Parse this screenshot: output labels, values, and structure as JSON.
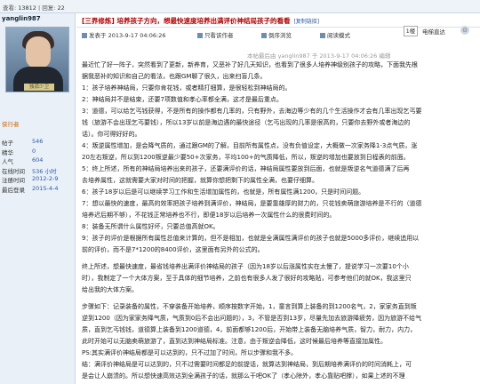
{
  "topbar": {
    "stats_label": "查看: ",
    "stats_views": "13812",
    "stats_sep": " | 回复: ",
    "stats_replies": "22"
  },
  "user": {
    "name": "yanglin987",
    "avatar_caption": "独孤少卫",
    "role": "侠行者",
    "stats": [
      {
        "k": "帖子",
        "v": "546"
      },
      {
        "k": "精华",
        "v": "0"
      },
      {
        "k": "人气",
        "v": "604"
      },
      {
        "k": "在线时间",
        "v": "536 小时"
      },
      {
        "k": "注册时间",
        "v": "2012-2-9"
      },
      {
        "k": "最后登录",
        "v": "2015-4-4"
      }
    ]
  },
  "thread": {
    "title": "[三界修炼] 培养孩子方向，想最快速度培养出满评价神结局孩子的看看",
    "copy_link": "[复制链接]",
    "page_value": "1楼",
    "goto_label": "电梯直达",
    "posted_at": "发表于 2013-9-17 04:06:26",
    "only_author": "只看该作者",
    "reverse": "倒序浏览",
    "more": "阅读模式",
    "edited_note": "本帖最后由 yanglin987 于 2013-9-17 04:06:26 编辑"
  },
  "body": [
    "最近忙了好一阵子，突然看到了更新，新养育，又恶补了好几天知识，也看到了很多人培养神级别孩子的攻略，下面我先根",
    "据我恶补的知识和自己的看法，也跟GM聊了很久，出来扫盲几条。",
    "1：孩子培养神结局，只要你肯花钱，或者精打细算，是很轻松到神结局的。",
    "2：神结局并不是结束，还要7项数值和孝心率都全满，这才是最后重点。",
    "3：道德，可以给乞丐钱获得，不是所有的操作都有几率的，只有野外，去海边等少有的几个生活操作才会有几率出现乞丐要",
    "钱（旅游不会出现乞丐要钱），所以13岁以前是海边遇的最快途径（乞丐出现的几率是很高的，只要你去野外或者海边的",
    "话）。你可得好好的。",
    "4：叛逆属性增加，是会降气质的，通过跟GM的了解，目前所有属性点，没有负值设定，大概做一次家务降1-3点气质，涨",
    "20左右叛逆，所以到1200叛逆最少要50+次家务，平均100+的气质降低，所以，叛逆的增加也要放到日程表的前面。",
    "5：终上所述，所有的神结局培养出来的孩子，还要满评价的话，神结局属性要放到后面，也就是叛逆名气道德满了后再",
    "去培养属性，这就需要大家对时间的把握，就算你想把剩下的属性全满，也要仔细算。",
    "6：孩子18岁以后是可以继续学习工作和生活增加属性的，也就是，所有属性满1200，只是时间问题。",
    "7：想以最快的速度，最高的效率把孩子培养到满评价，神结局，是要靠雄厚的财力的，只花钱卖萌旅游培养是不行的（道德",
    "培养迟后期不够），不花钱正常培养也不行，即便18岁以后培养一次属性什么的很费时间的。",
    "8：装备无所谓什么属性好坏，只要总值高就OK。",
    "9：孩子的评价是根据所有属性总值来计算的，但不是相加，也就是全满属性满评价的孩子也就是5000多评价，继续追用以",
    "前的评价，而不是7*1200的8400评价，这里面有另外的公式的。",
    "",
    "终上所述，想最快速度，最省钱培养出满评价神结局的孩子（因为18岁以后涨属性实在太慢了，提说学习一次要10个小",
    "时），我制定了一个大体方案，至于具体的细节培养，之前也有很多人发了很好的攻略贴，可参考他们的就OK，我这里只",
    "给出我的大体方案。",
    "",
    "步骤如下：记录装备的属性，不穿装备开始培养，顺序按数字开始，1，童言到算上装备的到1200名气，2，家家务直到叛",
    "逆到1200（因为家家务降气质，气质到0后不会出问题的），3，不管是否到13岁，尽量先加去旅游降疲劳，因为旅游不给气",
    "质，直到乞丐钱钱，道德算上装备到1200道德，4，前面都够1200后，开始带上装备无脑培养气质，智力，耐力，内力，",
    "此时开始可以无脑卖萌旅游了，直到达到神结局标准。注意，由于叛逆会降低，这时候最后培养等直接加属性。",
    "PS:其实满评价神结局都是可以达到的，只不过加了时间，所以步骤和我不多。",
    "结：满评价神结局是可以达到的，只不过需要时间都足的前提话，就算达到神结局，到后期培养满评价的时间消耗上，可",
    "是会让人崩溃的。所以想快速高效达到全满孩子的话，就那么干吧OK了（孝心除外，孝心靠贴吧撑），如果上述的不理"
  ]
}
